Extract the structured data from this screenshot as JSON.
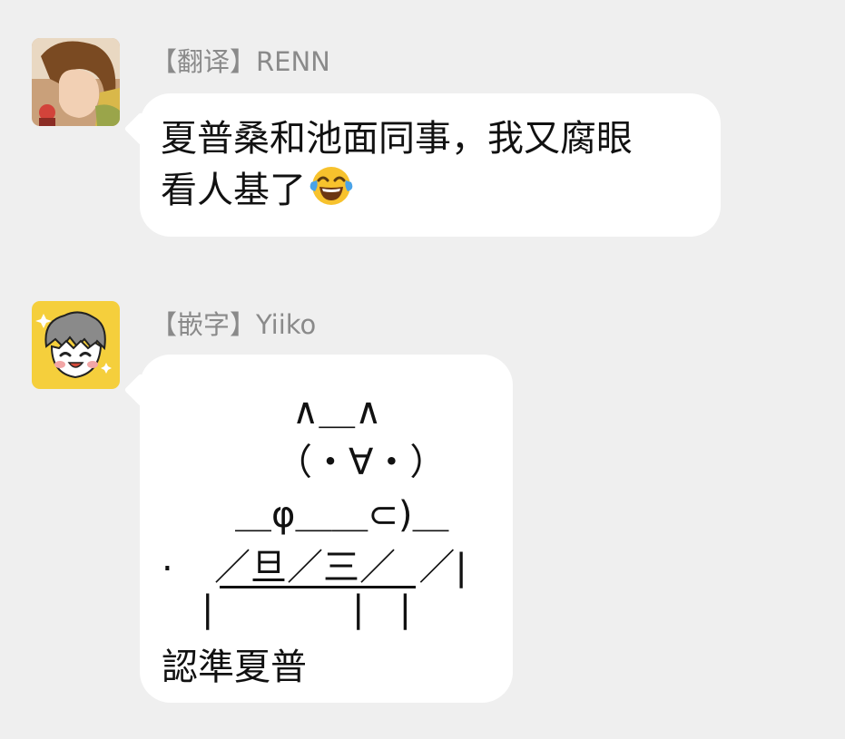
{
  "messages": [
    {
      "sender": "【翻译】RENN",
      "text_line1": "夏普桑和池面同事，我又腐眼",
      "text_line2": "看人基了",
      "emoji": "face-with-tears-of-joy"
    },
    {
      "sender": "【嵌字】Yiiko",
      "art": {
        "line1": "∧＿∧",
        "line2": "（・∀・）",
        "line3": "＿φ＿＿⊂)＿",
        "line4_dot": ".",
        "line4": "／旦／三／  ／|",
        "line5": "|            |   |"
      },
      "text": "認準夏普"
    }
  ]
}
